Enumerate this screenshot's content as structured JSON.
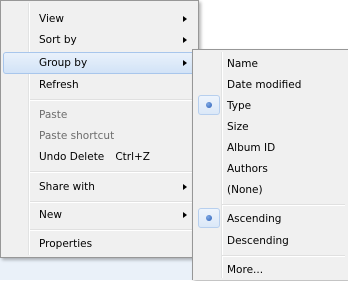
{
  "context_menu": {
    "items": [
      {
        "label": "View"
      },
      {
        "label": "Sort by"
      },
      {
        "label": "Group by"
      },
      {
        "label": "Refresh"
      },
      {
        "label": "Paste"
      },
      {
        "label": "Paste shortcut"
      },
      {
        "label": "Undo Delete",
        "shortcut": "Ctrl+Z"
      },
      {
        "label": "Share with"
      },
      {
        "label": "New"
      },
      {
        "label": "Properties"
      }
    ]
  },
  "group_by_submenu": {
    "items": [
      {
        "label": "Name"
      },
      {
        "label": "Date modified"
      },
      {
        "label": "Type",
        "selected": true
      },
      {
        "label": "Size"
      },
      {
        "label": "Album ID"
      },
      {
        "label": "Authors"
      },
      {
        "label": "(None)"
      },
      {
        "label": "Ascending",
        "selected": true
      },
      {
        "label": "Descending"
      },
      {
        "label": "More..."
      }
    ]
  }
}
